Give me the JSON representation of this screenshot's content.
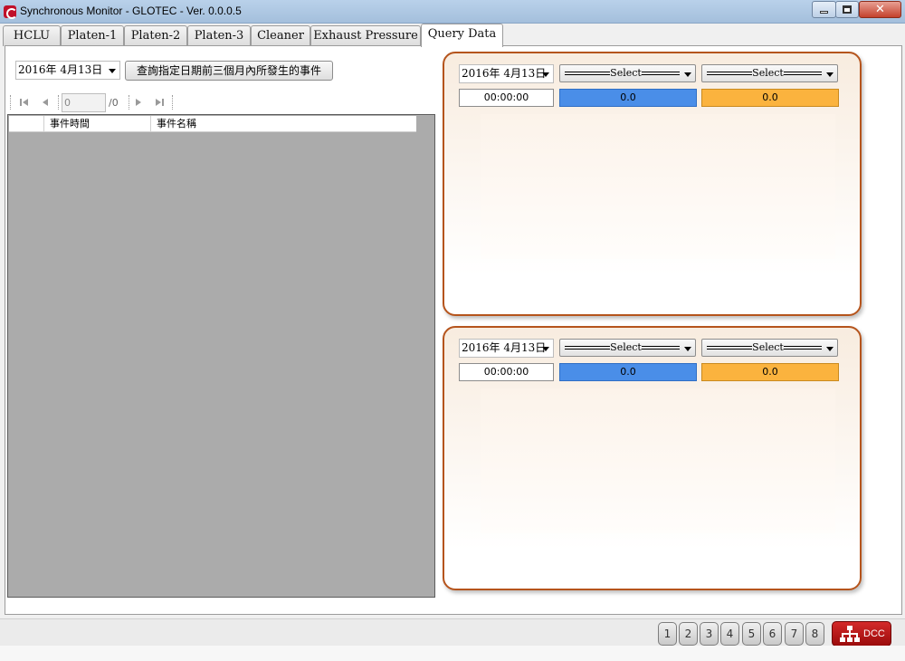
{
  "window": {
    "title": "Synchronous Monitor - GLOTEC - Ver. 0.0.0.5",
    "minimize_icon": "minimize-icon",
    "maximize_icon": "maximize-icon",
    "close_glyph": "✕"
  },
  "tabs": [
    {
      "label": "HCLU"
    },
    {
      "label": "Platen-1"
    },
    {
      "label": "Platen-2"
    },
    {
      "label": "Platen-3"
    },
    {
      "label": "Cleaner"
    },
    {
      "label": "Exhaust Pressure"
    },
    {
      "label": "Query Data",
      "active": true
    }
  ],
  "query": {
    "date": "2016年  4月13日",
    "button_label": "查詢指定日期前三個月內所發生的事件"
  },
  "pager": {
    "page": "0",
    "total": "/0"
  },
  "event_grid": {
    "columns": [
      "事件時間",
      "事件名稱"
    ],
    "rows": []
  },
  "charts": [
    {
      "date": "2016年  4月13日",
      "select1": "Select",
      "select2": "Select",
      "time": "00:00:00",
      "value_blue": "0.0",
      "value_orange": "0.0"
    },
    {
      "date": "2016年  4月13日",
      "select1": "Select",
      "select2": "Select",
      "time": "00:00:00",
      "value_blue": "0.0",
      "value_orange": "0.0"
    }
  ],
  "status": {
    "buttons": [
      "1",
      "2",
      "3",
      "4",
      "5",
      "6",
      "7",
      "8"
    ],
    "dcc_label": "DCC",
    "colors": {
      "accent_red": "#c41a1a",
      "blue": "#4a8ee8",
      "orange": "#fbb33e",
      "panel_border": "#b5541c"
    }
  }
}
